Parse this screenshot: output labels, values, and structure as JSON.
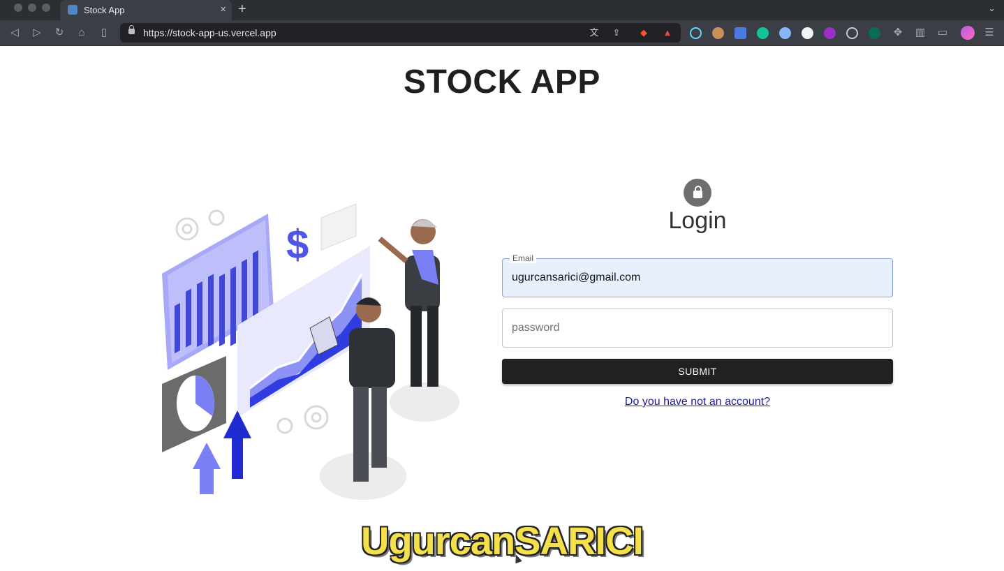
{
  "browser": {
    "tab_title": "Stock App",
    "tab_close": "×",
    "new_tab": "+",
    "url": "https://stock-app-us.vercel.app",
    "icons": [
      "back-icon",
      "forward-icon",
      "reload-icon",
      "home-icon",
      "bookmark-icon",
      "translate-icon",
      "share-icon",
      "brave-shields-icon",
      "brave-rewards-icon",
      "react-devtools-icon",
      "extension-icons",
      "puzzle-icon",
      "sidebar-icon",
      "wallet-icon",
      "profile-icon",
      "menu-icon"
    ]
  },
  "page": {
    "title": "STOCK APP"
  },
  "login": {
    "heading": "Login",
    "email_label": "Email",
    "email_value": "ugurcansarici@gmail.com",
    "password_placeholder": "password",
    "submit_label": "SUBMIT",
    "register_link": "Do you have not an account?"
  },
  "watermark": "UgurcanSARICI",
  "colors": {
    "accent_purple": "#7b7ff5",
    "accent_blue": "#2f3de0",
    "submit_bg": "#212121",
    "email_field_bg": "#e8f0fe",
    "watermark_yellow": "#f4e04d"
  }
}
